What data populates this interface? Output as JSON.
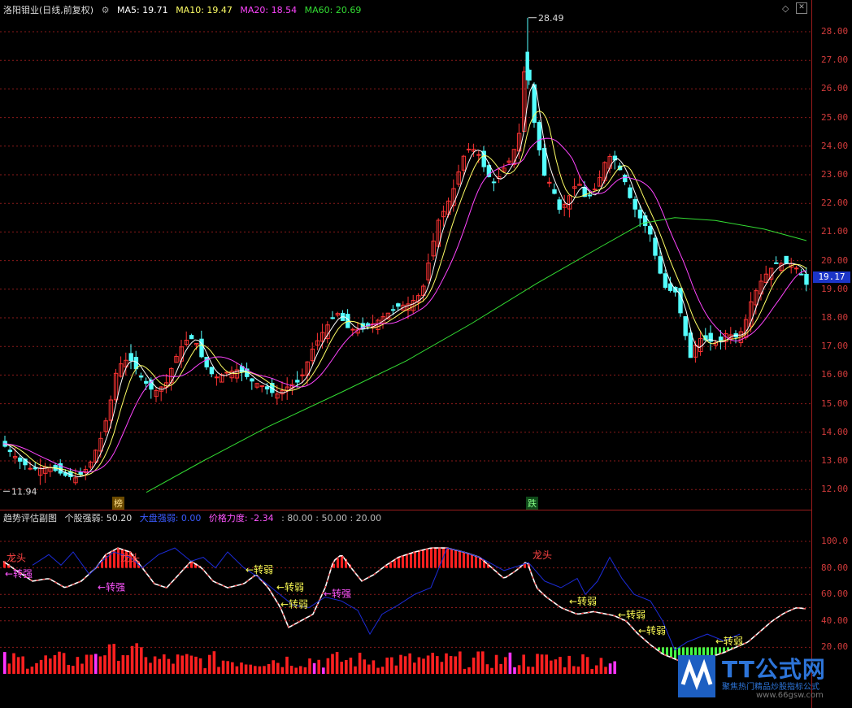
{
  "main": {
    "symbol": "洛阳钼业(日线,前复权)",
    "ma5": "MA5: 19.71",
    "ma10": "MA10: 19.47",
    "ma20": "MA20: 18.54",
    "ma60": "MA60: 20.69",
    "high_label": "28.49",
    "low_label": "11.94",
    "current_price": "19.17",
    "tag_bang": "榜",
    "tag_die": "跌",
    "y_ticks": [
      "28.00",
      "27.00",
      "26.00",
      "25.00",
      "24.00",
      "23.00",
      "22.00",
      "21.00",
      "20.00",
      "19.00",
      "18.00",
      "17.00",
      "16.00",
      "15.00",
      "14.00",
      "13.00",
      "12.00"
    ]
  },
  "sub": {
    "title": "趋势评估副图",
    "stock_strength": "个股强弱: 50.20",
    "market_strength": "大盘强弱: 0.00",
    "price_force": "价格力度: -2.34",
    "levels": ": 80.00 : 50.00 : 20.00",
    "y_ticks": [
      "100.0",
      "80.00",
      "60.00",
      "40.00",
      "20.00"
    ],
    "labels": {
      "long_head": "龙头",
      "turn_strong": "←转强",
      "turn_weak": "←转弱"
    }
  },
  "watermark": {
    "title": "TT公式网",
    "subtitle": "聚焦热门精品炒股指标公式",
    "url": "www.66gsw.com"
  },
  "colors": {
    "up": "#ff3333",
    "down": "#54ffff",
    "ma5": "#ffffff",
    "ma10": "#ffff66",
    "ma20": "#ff44ff",
    "ma60": "#33dd33",
    "grid": "#8a1a1a",
    "market_line": "#1c2bd6"
  },
  "chart_data": {
    "type": "candlestick",
    "y_range": [
      11.5,
      29.0
    ],
    "high": 28.49,
    "low": 11.94,
    "last": 19.17
  }
}
